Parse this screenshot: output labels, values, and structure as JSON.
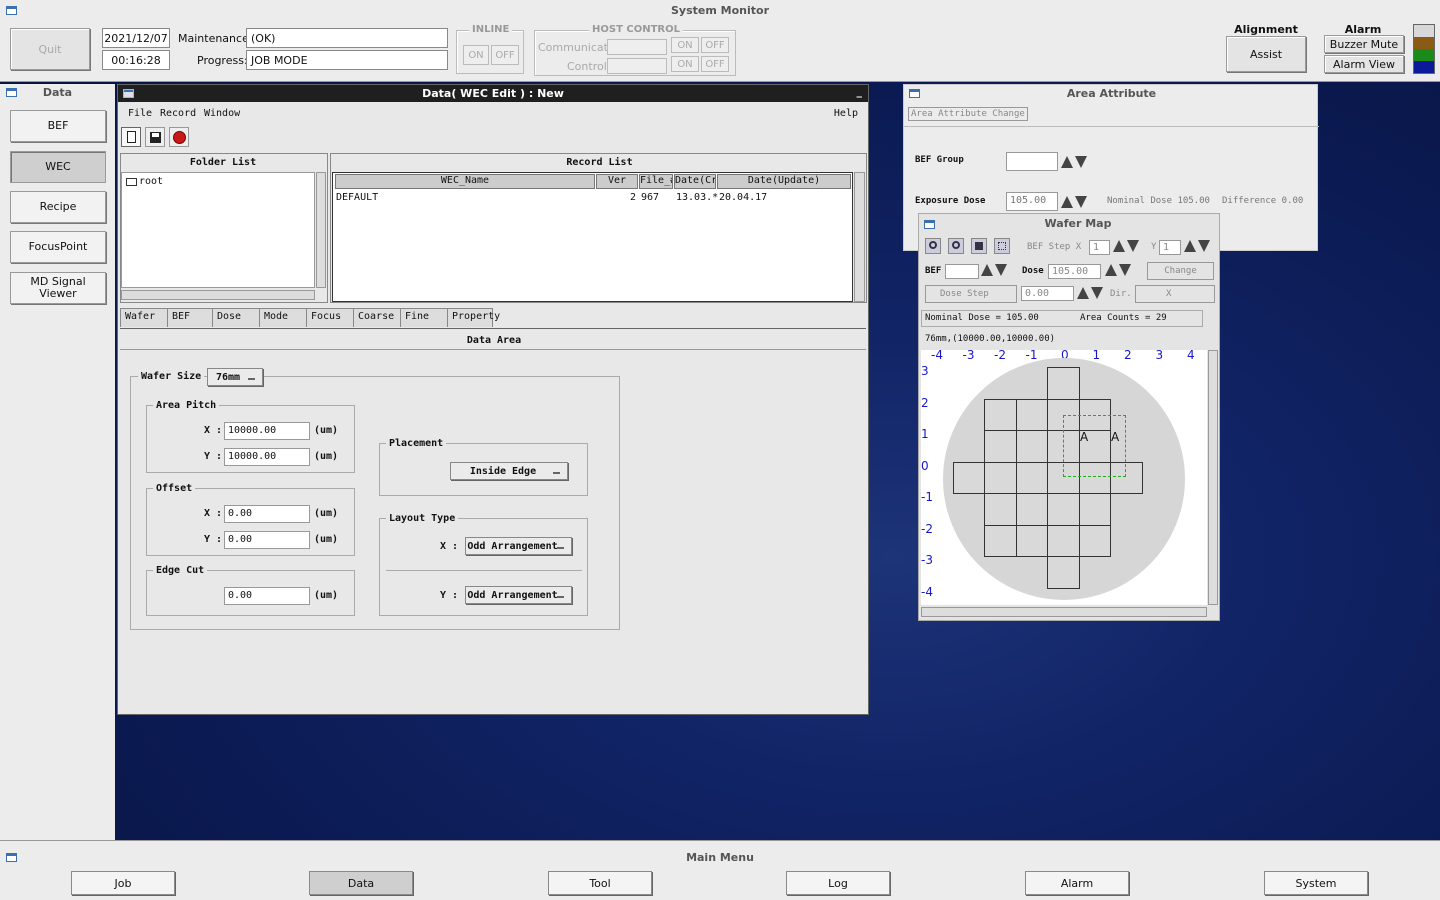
{
  "system": {
    "title": "System Monitor",
    "quit": "Quit",
    "date": "2021/12/07",
    "time": "00:16:28",
    "maintenance_label": "Maintenance:",
    "maintenance_value": "(OK)",
    "progress_label": "Progress:",
    "progress_value": "JOB MODE",
    "inline_label": "INLINE",
    "on": "ON",
    "off": "OFF",
    "host_label": "HOST CONTROL",
    "communicate": "Communicate",
    "control": "Control:",
    "alignment_label": "Alignment",
    "assist": "Assist",
    "alarm_label": "Alarm",
    "buzzer_mute": "Buzzer Mute",
    "alarm_view": "Alarm View",
    "status_colors": [
      "#d8d8d8",
      "#8b5a14",
      "#1a8a1a",
      "#0a1a9a"
    ]
  },
  "sidebar": {
    "title": "Data",
    "items": [
      "BEF",
      "WEC",
      "Recipe",
      "FocusPoint",
      "MD Signal Viewer"
    ],
    "selected": "WEC"
  },
  "data_window": {
    "title": "Data( WEC Edit ) : New",
    "minimize": "_",
    "menu": [
      "File",
      "Record",
      "Window"
    ],
    "help": "Help",
    "folder_list_title": "Folder List",
    "folder_root": "root",
    "record_list_title": "Record List",
    "columns": [
      "WEC_Name",
      "Ver",
      "File_#",
      "Date(Cr",
      "Date(Update)"
    ],
    "rows": [
      {
        "name": "DEFAULT",
        "ver": "2",
        "file": "967",
        "created": "13.03.*",
        "updated": "20.04.17"
      }
    ],
    "tabs": [
      "Wafer",
      "BEF",
      "Dose",
      "Mode",
      "Focus",
      "Coarse",
      "Fine",
      "Property"
    ],
    "data_area_title": "Data Area",
    "wafer_size_label": "Wafer Size",
    "wafer_size": "76mm",
    "area_pitch_label": "Area Pitch",
    "x_label": "X :",
    "y_label": "Y :",
    "pitch_x": "10000.00",
    "pitch_y": "10000.00",
    "unit": "(um)",
    "offset_label": "Offset",
    "offset_x": "0.00",
    "offset_y": "0.00",
    "edge_cut_label": "Edge Cut",
    "edge_cut": "0.00",
    "placement_label": "Placement",
    "placement": "Inside Edge",
    "layout_type_label": "Layout Type",
    "layout_x": "Odd Arrangement",
    "layout_y": "Odd Arrangement"
  },
  "area_attribute": {
    "title": "Area Attribute",
    "change_btn": "Area Attribute Change",
    "bef_group_label": "BEF Group",
    "bef_group_value": "",
    "exposure_dose_label": "Exposure Dose",
    "exposure_dose_value": "105.00",
    "nominal_dose": "Nominal Dose 105.00",
    "difference": "Difference 0.00"
  },
  "wafer_map": {
    "title": "Wafer Map",
    "bef_step_x_label": "BEF Step X",
    "bef_step_x": "1",
    "y_label": "Y",
    "bef_step_y": "1",
    "bef_label": "BEF",
    "bef_value": "",
    "dose_label": "Dose",
    "dose_value": "105.00",
    "change": "Change",
    "dose_step": "Dose Step",
    "dose_step_value": "0.00",
    "dir_label": "Dir.",
    "dir_value": "X",
    "nominal": "Nominal Dose = 105.00",
    "area_counts": "Area Counts = 29",
    "info": "76mm,(10000.00,10000.00)",
    "x_ticks": [
      "-4",
      "-3",
      "-2",
      "-1",
      "0",
      "1",
      "2",
      "3",
      "4"
    ],
    "y_ticks": [
      "3",
      "2",
      "1",
      "0",
      "-1",
      "-2",
      "-3",
      "-4"
    ],
    "mark": "A"
  },
  "main_menu": {
    "title": "Main Menu",
    "items": [
      "Job",
      "Data",
      "Tool",
      "Log",
      "Alarm",
      "System"
    ],
    "selected": "Data"
  }
}
